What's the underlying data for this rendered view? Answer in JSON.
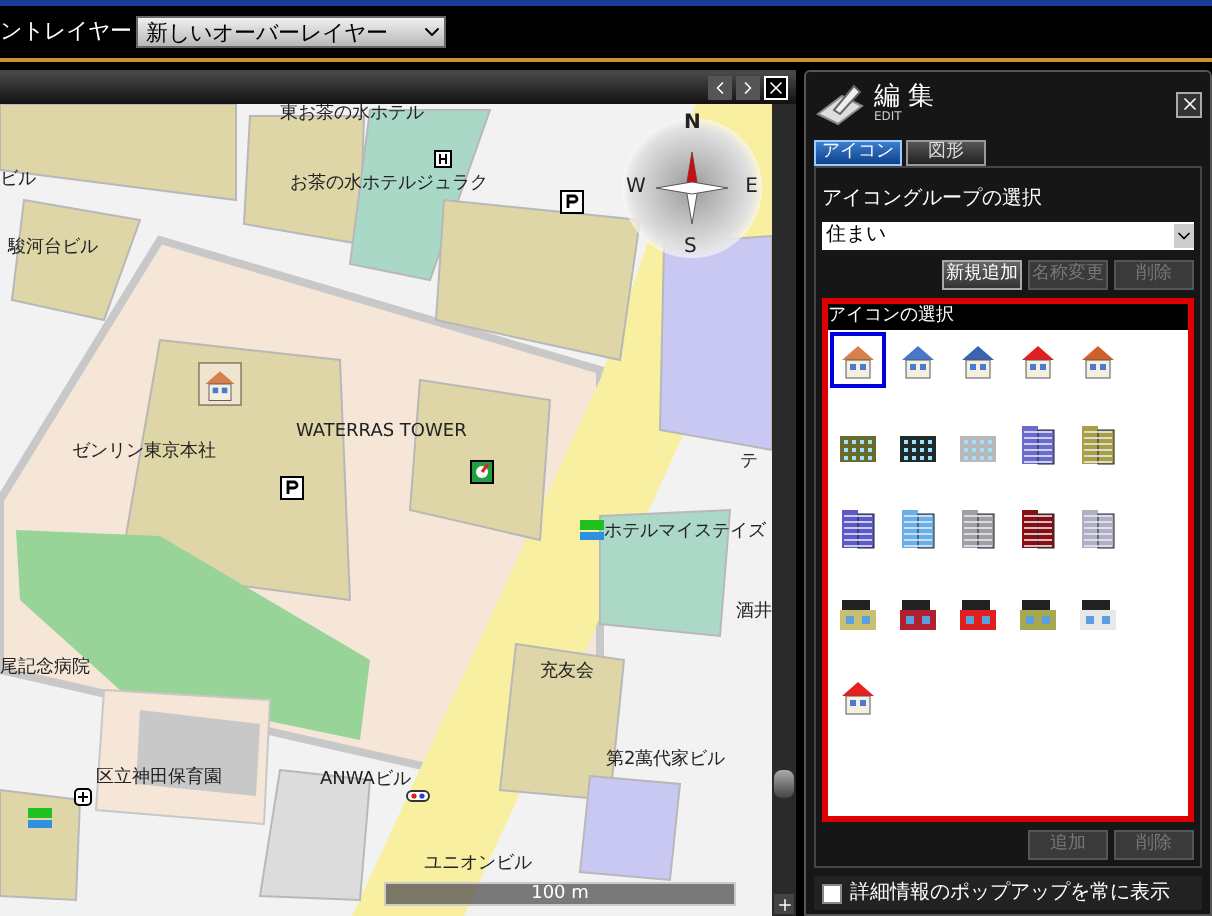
{
  "toolbar": {
    "label": "ントレイヤー",
    "layer_select": {
      "value": "新しいオーバーレイヤー"
    }
  },
  "map": {
    "labels": [
      {
        "text": "東お茶の水ホテル"
      },
      {
        "text": "ビル"
      },
      {
        "text": "お茶の水ホテルジュラク"
      },
      {
        "text": "駿河台ビル"
      },
      {
        "text": "WATERRAS TOWER"
      },
      {
        "text": "ゼンリン東京本社"
      },
      {
        "text": "テ"
      },
      {
        "text": "ホテルマイステイズ"
      },
      {
        "text": "酒井"
      },
      {
        "text": "尾記念病院"
      },
      {
        "text": "充友会"
      },
      {
        "text": "区立神田保育園"
      },
      {
        "text": "ANWAビル"
      },
      {
        "text": "第2萬代家ビル"
      },
      {
        "text": "ユニオンビル"
      }
    ],
    "compass": {
      "north": "N",
      "east": "E",
      "south": "S",
      "west": "W"
    },
    "scale": "100 m",
    "zoom_slider": {
      "level": 0.12
    }
  },
  "edit_panel": {
    "title": "編 集",
    "subtitle": "EDIT",
    "tabs": [
      {
        "label": "アイコン",
        "selected": true
      },
      {
        "label": "図形",
        "selected": false
      }
    ],
    "group_label": "アイコングループの選択",
    "group_select": {
      "value": "住まい"
    },
    "group_buttons": [
      {
        "label": "新規追加",
        "disabled": false
      },
      {
        "label": "名称変更",
        "disabled": true
      },
      {
        "label": "削除",
        "disabled": true
      }
    ],
    "icon_section_title": "アイコンの選択",
    "icons": [
      {
        "kind": "house",
        "color": "#d9804a",
        "selected": true
      },
      {
        "kind": "house",
        "color": "#4a78c8",
        "selected": false
      },
      {
        "kind": "house",
        "color": "#3a64b0",
        "selected": false
      },
      {
        "kind": "house",
        "color": "#e02020",
        "selected": false
      },
      {
        "kind": "house",
        "color": "#d0602a",
        "selected": false
      },
      {
        "kind": "apartment",
        "color": "#6a6a2a",
        "selected": false
      },
      {
        "kind": "apartment",
        "color": "#1e2a2a",
        "selected": false
      },
      {
        "kind": "apartment",
        "color": "#b8b8b8",
        "selected": false
      },
      {
        "kind": "tower",
        "color": "#6a6acc",
        "selected": false
      },
      {
        "kind": "tower",
        "color": "#a8a040",
        "selected": false
      },
      {
        "kind": "tower",
        "color": "#5a5ac8",
        "selected": false
      },
      {
        "kind": "tower",
        "color": "#68b0e8",
        "selected": false
      },
      {
        "kind": "tower",
        "color": "#a0a0a0",
        "selected": false
      },
      {
        "kind": "tower",
        "color": "#8a1010",
        "selected": false
      },
      {
        "kind": "tower",
        "color": "#b0b0c0",
        "selected": false
      },
      {
        "kind": "shop",
        "color": "#c8c070",
        "selected": false
      },
      {
        "kind": "shop",
        "color": "#b02030",
        "selected": false
      },
      {
        "kind": "shop",
        "color": "#e02020",
        "selected": false
      },
      {
        "kind": "shop",
        "color": "#a8a850",
        "selected": false
      },
      {
        "kind": "shop",
        "color": "#e8e8e8",
        "selected": false
      },
      {
        "kind": "house",
        "color": "#e82020",
        "selected": false
      }
    ],
    "icon_buttons": [
      {
        "label": "追加",
        "disabled": true
      },
      {
        "label": "削除",
        "disabled": true
      }
    ],
    "popup_checkbox": {
      "label": "詳細情報のポップアップを常に表示",
      "checked": false
    }
  }
}
